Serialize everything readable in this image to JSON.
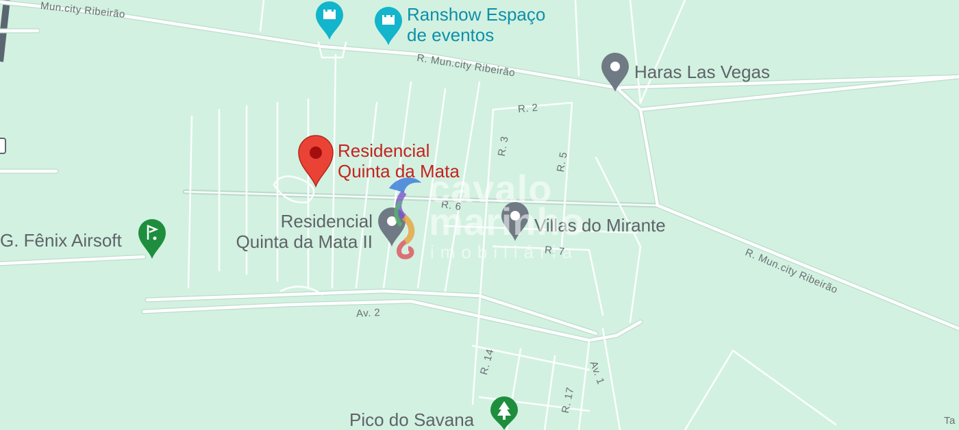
{
  "map": {
    "background_color": "#d2f1e1",
    "road_color": "#ffffff",
    "road_casing_color": "#b9d8c9",
    "highway_color": "#5b6770"
  },
  "places": {
    "residencial_qm": {
      "line1": "Residencial",
      "line2": "Quinta da Mata",
      "icon": "red-location-pin-icon",
      "color": "#d93025"
    },
    "residencial_qm2": {
      "line1": "Residencial",
      "line2": "Quinta da Mata II",
      "icon": "gray-location-pin-icon",
      "color": "#6f7a84"
    },
    "ranshow": {
      "line1": "Ranshow Espaço",
      "line2": "de eventos",
      "icon": "castle-icon",
      "color": "#12b5cb"
    },
    "haras": {
      "name": "Haras Las Vegas",
      "icon": "gray-location-pin-icon"
    },
    "villas": {
      "name": "Villas do Mirante",
      "icon": "gray-location-pin-icon"
    },
    "fenix": {
      "name": "G. Fênix Airsoft",
      "icon": "golf-icon",
      "color": "#1e8e3e"
    },
    "pico": {
      "name": "Pico do Savana",
      "icon": "tree-icon",
      "color": "#1e8e3e"
    }
  },
  "streets": {
    "mun_ribeirao_top_left": "Mun.city Ribeirão",
    "mun_ribeirao_mid": "R. Mun.city Ribeirão",
    "mun_ribeirao_right": "R. Mun.city Ribeirão",
    "r2": "R. 2",
    "r3": "R. 3",
    "r5": "R. 5",
    "r6": "R. 6",
    "r7": "R. 7",
    "r14": "R. 14",
    "r17": "R. 17",
    "av1": "Av. 1",
    "av2": "Av. 2"
  },
  "edge_labels": {
    "right_bottom": "Ta"
  },
  "watermark": {
    "line1": "cavalo",
    "line2": "marinho",
    "line3": "imobiliária"
  }
}
